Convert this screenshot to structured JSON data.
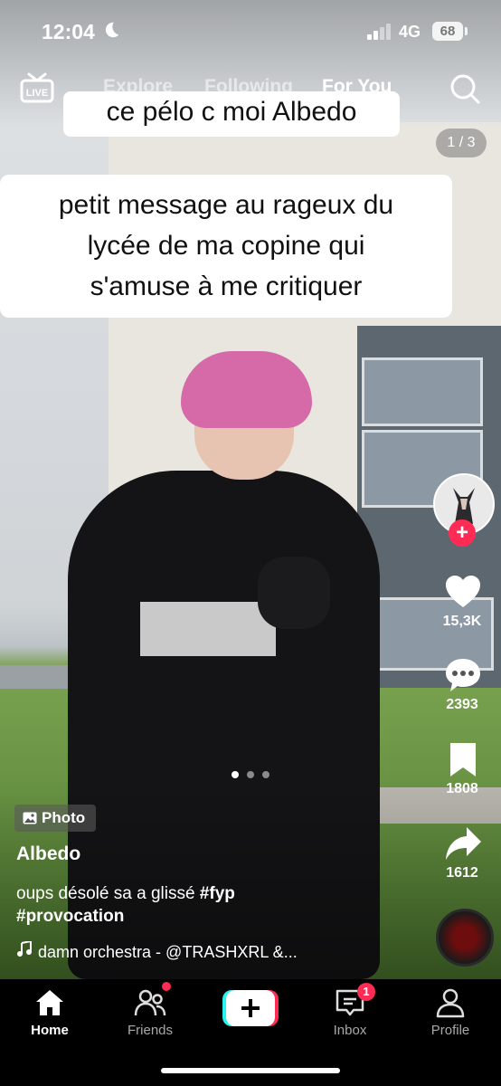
{
  "status_bar": {
    "time": "12:04",
    "network": "4G",
    "battery": "68"
  },
  "top_nav": {
    "live_label": "LIVE",
    "tabs": [
      {
        "label": "Explore",
        "active": false
      },
      {
        "label": "Following",
        "active": false
      },
      {
        "label": "For You",
        "active": true
      }
    ]
  },
  "captions": {
    "line1": "ce pélo c moi Albedo",
    "block": [
      "petit message au rageux du",
      "lycée de ma copine qui",
      "s'amuse à me critiquer"
    ]
  },
  "photo_counter": "1 / 3",
  "photo_page": {
    "current": 1,
    "total": 3
  },
  "right_rail": {
    "likes": "15,3K",
    "comments": "2393",
    "saves": "1808",
    "shares": "1612"
  },
  "post": {
    "type_badge": "Photo",
    "author": "Albedo",
    "description": "oups désolé sa a glissé",
    "hashtags": [
      "#fyp",
      "#provocation"
    ],
    "sound": "damn orchestra - @TRASHXRL &..."
  },
  "tab_bar": {
    "items": [
      {
        "label": "Home",
        "active": true
      },
      {
        "label": "Friends",
        "active": false
      },
      {
        "label": "Inbox",
        "active": false
      },
      {
        "label": "Profile",
        "active": false
      }
    ],
    "inbox_badge": "1"
  },
  "colors": {
    "accent": "#fe2c55",
    "caption_bg": "#ffffff",
    "tabbar_bg": "#000000"
  }
}
